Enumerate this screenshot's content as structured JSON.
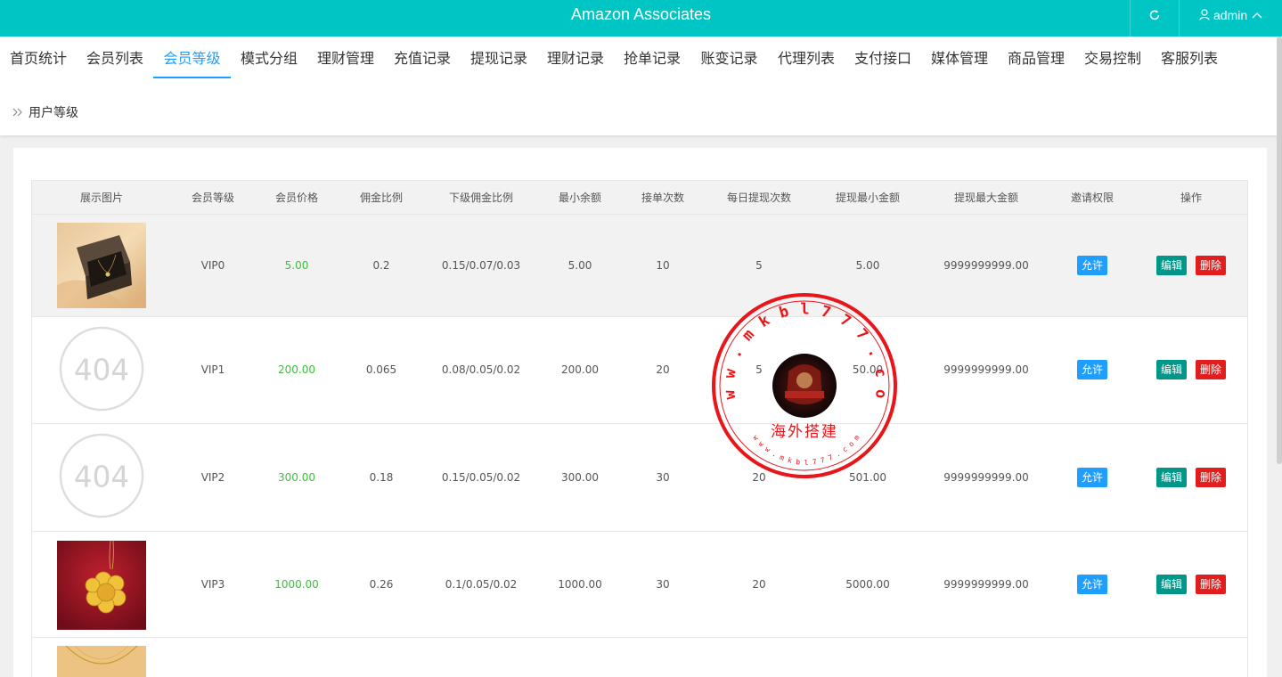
{
  "app": {
    "title": "Amazon Associates",
    "user": "admin",
    "accent_color": "#00c5c5",
    "refresh_icon": "refresh-icon",
    "user_icon": "user-icon",
    "chevron_icon": "chevron-up-icon"
  },
  "nav": {
    "tabs": [
      {
        "label": "首页统计"
      },
      {
        "label": "会员列表"
      },
      {
        "label": "会员等级",
        "active": true
      },
      {
        "label": "模式分组"
      },
      {
        "label": "理财管理"
      },
      {
        "label": "充值记录"
      },
      {
        "label": "提现记录"
      },
      {
        "label": "理财记录"
      },
      {
        "label": "抢单记录"
      },
      {
        "label": "账变记录"
      },
      {
        "label": "代理列表"
      },
      {
        "label": "支付接口"
      },
      {
        "label": "媒体管理"
      },
      {
        "label": "商品管理"
      },
      {
        "label": "交易控制"
      },
      {
        "label": "客服列表"
      }
    ]
  },
  "breadcrumb": {
    "icon": "double-chevron-right-icon",
    "label": "用户等级"
  },
  "table": {
    "headers": [
      "展示图片",
      "会员等级",
      "会员价格",
      "佣金比例",
      "下级佣金比例",
      "最小余额",
      "接单次数",
      "每日提现次数",
      "提现最小金额",
      "提现最大金额",
      "邀请权限",
      "操作"
    ],
    "rows": [
      {
        "image": "gift-box-photo",
        "level": "VIP0",
        "price": "5.00",
        "commission": "0.2",
        "sub_commission": "0.15/0.07/0.03",
        "min_balance": "5.00",
        "orders": "10",
        "daily_withdraw": "5",
        "withdraw_min": "5.00",
        "withdraw_max": "9999999999.00",
        "invite": "允许",
        "edit": "编辑",
        "delete": "删除"
      },
      {
        "image": "404-placeholder",
        "image_text": "404",
        "level": "VIP1",
        "price": "200.00",
        "commission": "0.065",
        "sub_commission": "0.08/0.05/0.02",
        "min_balance": "200.00",
        "orders": "20",
        "daily_withdraw": "5",
        "withdraw_min": "50.00",
        "withdraw_max": "9999999999.00",
        "invite": "允许",
        "edit": "编辑",
        "delete": "删除"
      },
      {
        "image": "404-placeholder",
        "image_text": "404",
        "level": "VIP2",
        "price": "300.00",
        "commission": "0.18",
        "sub_commission": "0.15/0.05/0.02",
        "min_balance": "300.00",
        "orders": "30",
        "daily_withdraw": "20",
        "withdraw_min": "501.00",
        "withdraw_max": "9999999999.00",
        "invite": "允许",
        "edit": "编辑",
        "delete": "删除"
      },
      {
        "image": "gold-pendant-photo",
        "level": "VIP3",
        "price": "1000.00",
        "commission": "0.26",
        "sub_commission": "0.1/0.05/0.02",
        "min_balance": "1000.00",
        "orders": "30",
        "daily_withdraw": "20",
        "withdraw_min": "5000.00",
        "withdraw_max": "9999999999.00",
        "invite": "允许",
        "edit": "编辑",
        "delete": "删除"
      }
    ]
  },
  "watermark": {
    "outer_text": "w w w . m k b l 7 7 7 . c o m",
    "center_text": "海外搭建",
    "inner_text": "w w w . m k b l 7 7 7 . c o m",
    "color": "#e8161b"
  }
}
